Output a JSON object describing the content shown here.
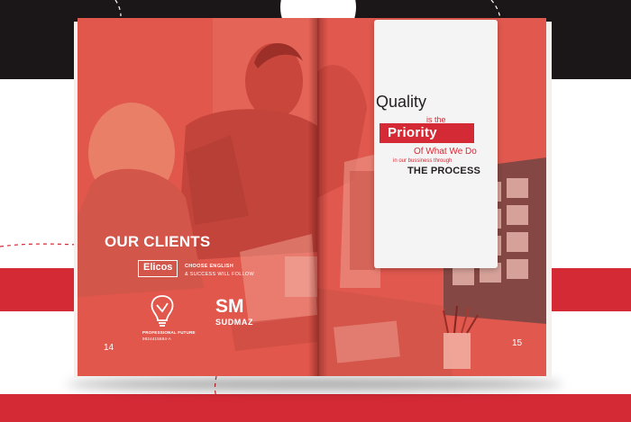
{
  "colors": {
    "brand_red": "#d42a36",
    "dark_band": "#1b1718",
    "page_overlay": "#e1574c",
    "card_white": "#f5f4f4"
  },
  "left_page": {
    "section_title": "OUR CLIENTS",
    "page_number": "14",
    "clients": [
      {
        "logo_text": "Elicos",
        "tagline_1": "CHOOSE ENGLISH",
        "tagline_2": "& SUCCESS WILL FOLLOW"
      },
      {
        "icon": "lightbulb-icon",
        "name": "PROFESSIONAL FUTURE",
        "code": "9824415584-A"
      },
      {
        "mark": "SM",
        "name": "SUDMAZ"
      }
    ]
  },
  "right_page": {
    "page_number": "15",
    "quote": {
      "line1": "Quality",
      "line2": "is the",
      "line3": "Priority",
      "line4": "Of What We Do",
      "line5": "in our bussiness through",
      "line6": "THE PROCESS"
    }
  }
}
